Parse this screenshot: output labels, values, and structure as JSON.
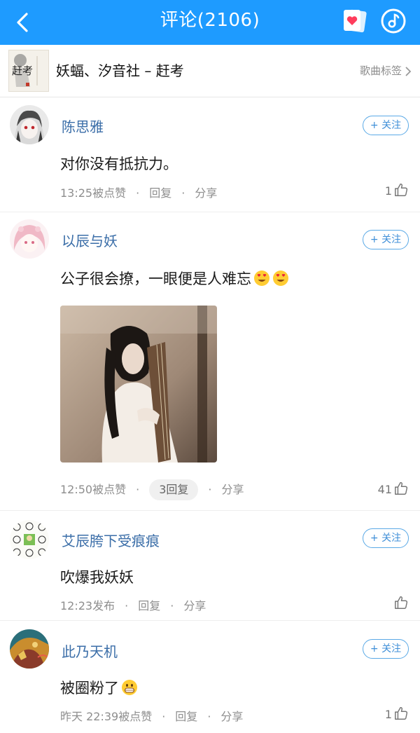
{
  "header": {
    "title": "评论(2106)"
  },
  "song": {
    "title": "妖蝠、汐音社 – 赶考",
    "tag_label": "歌曲标签",
    "cover_text": "赶考"
  },
  "colors": {
    "accent": "#1e9bff",
    "username": "#3b6ea8",
    "like_icon": "#777777"
  },
  "comments": [
    {
      "user": "陈思雅",
      "follow_label": "+ 关注",
      "text": "对你没有抵抗力。",
      "time": "13:25被点赞",
      "reply": "回复",
      "share": "分享",
      "likes": "1",
      "avatar_icon": "anime-girl-avatar"
    },
    {
      "user": "以辰与妖",
      "follow_label": "+ 关注",
      "text": "公子很会撩，一眼便是人难忘",
      "time": "12:50被点赞",
      "reply": "3回复",
      "share": "分享",
      "likes": "41",
      "avatar_icon": "pink-anime-avatar",
      "image_icon": "guqin-portrait-photo"
    },
    {
      "user": "艾辰胯下受痕痕",
      "follow_label": "+ 关注",
      "text": "吹爆我妖妖",
      "time": "12:23发布",
      "reply": "回复",
      "share": "分享",
      "likes": "",
      "avatar_icon": "sticker-grid-avatar"
    },
    {
      "user": "此乃天机",
      "follow_label": "+ 关注",
      "text": "被圈粉了",
      "time": "昨天 22:39被点赞",
      "reply": "回复",
      "share": "分享",
      "likes": "1",
      "avatar_icon": "golden-dragon-avatar"
    }
  ]
}
